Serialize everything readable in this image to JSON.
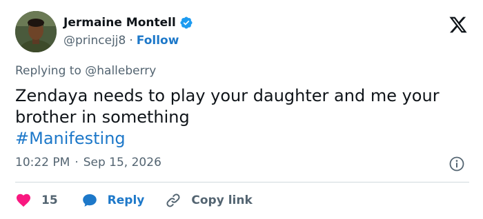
{
  "author": {
    "name": "Jermaine Montell",
    "handle": "@princejj8",
    "separator": "·",
    "follow_label": "Follow"
  },
  "reply_context": {
    "prefix": "Replying to",
    "mention": "@halleberry"
  },
  "tweet": {
    "text": "Zendaya needs to play your daughter and me your brother in something",
    "hashtag": "#Manifesting"
  },
  "meta": {
    "time": "10:22 PM",
    "separator": "·",
    "date": "Sep 15, 2026"
  },
  "actions": {
    "like_count": "15",
    "reply_label": "Reply",
    "copy_label": "Copy link"
  },
  "icons": {
    "verified": "verified-badge-icon",
    "logo": "x-logo-icon",
    "info": "info-icon",
    "like": "heart-icon",
    "reply": "speech-bubble-icon",
    "copy": "link-icon"
  },
  "colors": {
    "link_blue": "#1d78c9",
    "verified_blue": "#1d9bf0",
    "heart_pink": "#f91880",
    "muted_text": "#536471",
    "primary_text": "#0f1419"
  }
}
